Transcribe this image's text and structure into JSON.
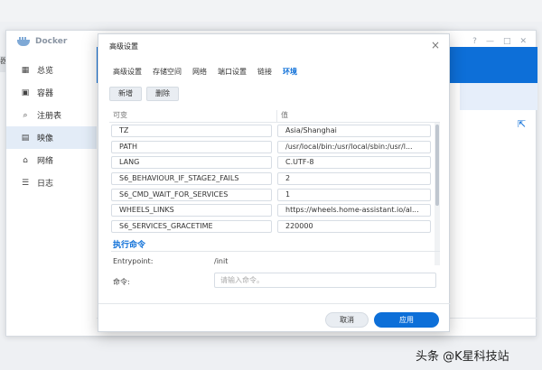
{
  "desktop": {
    "edge_label": "器"
  },
  "docker": {
    "title": "Docker",
    "controls": [
      "?",
      "—",
      "□",
      "✕"
    ],
    "sidebar": [
      {
        "label": "总览",
        "icon": "overview-icon",
        "glyph": "▦"
      },
      {
        "label": "容器",
        "icon": "container-icon",
        "glyph": "▣"
      },
      {
        "label": "注册表",
        "icon": "registry-icon",
        "glyph": "⌕"
      },
      {
        "label": "映像",
        "icon": "image-icon",
        "glyph": "▤"
      },
      {
        "label": "网络",
        "icon": "network-icon",
        "glyph": "⌂"
      },
      {
        "label": "日志",
        "icon": "log-icon",
        "glyph": "☰"
      }
    ],
    "active_item": "映像",
    "external_link_icon": "⇱"
  },
  "modal": {
    "title": "高级设置",
    "close": "×",
    "tabs": [
      "高级设置",
      "存储空间",
      "网络",
      "端口设置",
      "链接",
      "环境"
    ],
    "active_tab": "环境",
    "add_label": "新增",
    "delete_label": "删除",
    "col_variable": "可变",
    "col_value": "值",
    "env": [
      {
        "key": "TZ",
        "value": "Asia/Shanghai"
      },
      {
        "key": "PATH",
        "value": "/usr/local/bin:/usr/local/sbin:/usr/l..."
      },
      {
        "key": "LANG",
        "value": "C.UTF-8"
      },
      {
        "key": "S6_BEHAVIOUR_IF_STAGE2_FAILS",
        "value": "2"
      },
      {
        "key": "S6_CMD_WAIT_FOR_SERVICES",
        "value": "1"
      },
      {
        "key": "WHEELS_LINKS",
        "value": "https://wheels.home-assistant.io/al..."
      },
      {
        "key": "S6_SERVICES_GRACETIME",
        "value": "220000"
      }
    ],
    "exec_title": "执行命令",
    "entrypoint_label": "Entrypoint:",
    "entrypoint_value": "/init",
    "command_label": "命令:",
    "command_placeholder": "请输入命令。",
    "cancel_label": "取消",
    "apply_label": "应用"
  },
  "watermark": "头条 @K星科技站",
  "colors": {
    "accent": "#0d6fd8",
    "sidebar_active": "#e3ecf7"
  }
}
